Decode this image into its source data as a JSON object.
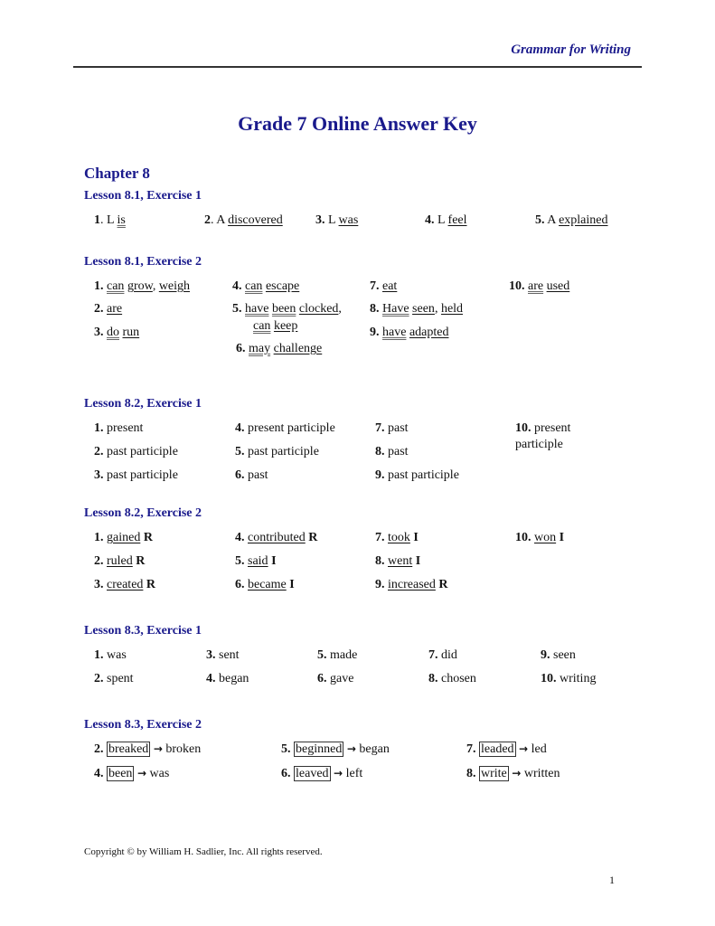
{
  "header": {
    "title": "Grammar for Writing"
  },
  "document": {
    "title": "Grade 7 Online Answer Key",
    "chapter": "Chapter 8"
  },
  "sections": [
    {
      "heading": "Lesson 8.1, Exercise 1",
      "answers": [
        {
          "num": "1",
          "sep": ". ",
          "parts": [
            {
              "t": "L "
            },
            {
              "t": "is",
              "s": "uu"
            }
          ]
        },
        {
          "num": "2",
          "sep": ". ",
          "parts": [
            {
              "t": "A "
            },
            {
              "t": "discovered",
              "s": "u"
            }
          ]
        },
        {
          "num": "3.",
          "sep": " ",
          "parts": [
            {
              "t": "L "
            },
            {
              "t": "was",
              "s": "u"
            }
          ]
        },
        {
          "num": "4.",
          "sep": " ",
          "parts": [
            {
              "t": "L "
            },
            {
              "t": "feel",
              "s": "u"
            }
          ]
        },
        {
          "num": "5.",
          "sep": " ",
          "parts": [
            {
              "t": "A "
            },
            {
              "t": "explained",
              "s": "u"
            }
          ]
        }
      ]
    },
    {
      "heading": "Lesson 8.1, Exercise 2",
      "answers": [
        {
          "num": "1.",
          "sep": " ",
          "parts": [
            {
              "t": "can",
              "s": "uu"
            },
            {
              "t": " "
            },
            {
              "t": "grow",
              "s": "u"
            },
            {
              "t": ", "
            },
            {
              "t": "weigh",
              "s": "u"
            }
          ]
        },
        {
          "num": "2.",
          "sep": " ",
          "parts": [
            {
              "t": "are",
              "s": "u"
            }
          ]
        },
        {
          "num": "3.",
          "sep": " ",
          "parts": [
            {
              "t": "do",
              "s": "uu"
            },
            {
              "t": " "
            },
            {
              "t": "run",
              "s": "u"
            }
          ]
        },
        {
          "num": "4.",
          "sep": " ",
          "parts": [
            {
              "t": "can",
              "s": "uu"
            },
            {
              "t": " "
            },
            {
              "t": "escape",
              "s": "u"
            }
          ]
        },
        {
          "num": "5.",
          "sep": " ",
          "parts": [
            {
              "t": "have",
              "s": "uu"
            },
            {
              "t": " "
            },
            {
              "t": "been",
              "s": "uu"
            },
            {
              "t": " "
            },
            {
              "t": "clocked",
              "s": "u"
            },
            {
              "t": ","
            }
          ],
          "cont": [
            {
              "t": "can",
              "s": "uu"
            },
            {
              "t": " "
            },
            {
              "t": "keep",
              "s": "u"
            }
          ]
        },
        {
          "num": "6.",
          "sep": " ",
          "parts": [
            {
              "t": "may",
              "s": "uu"
            },
            {
              "t": " "
            },
            {
              "t": "challenge",
              "s": "u"
            }
          ]
        },
        {
          "num": "7.",
          "sep": " ",
          "parts": [
            {
              "t": "eat",
              "s": "u"
            }
          ]
        },
        {
          "num": "8.",
          "sep": " ",
          "parts": [
            {
              "t": "Have",
              "s": "uu"
            },
            {
              "t": " "
            },
            {
              "t": "seen",
              "s": "u"
            },
            {
              "t": ", "
            },
            {
              "t": "held",
              "s": "u"
            }
          ]
        },
        {
          "num": "9.",
          "sep": " ",
          "parts": [
            {
              "t": "have",
              "s": "uu"
            },
            {
              "t": " "
            },
            {
              "t": "adapted",
              "s": "u"
            }
          ]
        },
        {
          "num": "10.",
          "sep": " ",
          "parts": [
            {
              "t": "are",
              "s": "uu"
            },
            {
              "t": " "
            },
            {
              "t": "used",
              "s": "u"
            }
          ]
        }
      ]
    },
    {
      "heading": "Lesson 8.2, Exercise 1",
      "answers": [
        {
          "num": "1.",
          "sep": " ",
          "parts": [
            {
              "t": "present"
            }
          ]
        },
        {
          "num": "2.",
          "sep": " ",
          "parts": [
            {
              "t": "past participle"
            }
          ]
        },
        {
          "num": "3.",
          "sep": " ",
          "parts": [
            {
              "t": "past participle"
            }
          ]
        },
        {
          "num": "4.",
          "sep": " ",
          "parts": [
            {
              "t": "present participle"
            }
          ]
        },
        {
          "num": "5.",
          "sep": " ",
          "parts": [
            {
              "t": "past participle"
            }
          ]
        },
        {
          "num": "6.",
          "sep": " ",
          "parts": [
            {
              "t": "past"
            }
          ]
        },
        {
          "num": "7.",
          "sep": " ",
          "parts": [
            {
              "t": "past"
            }
          ]
        },
        {
          "num": "8.",
          "sep": " ",
          "parts": [
            {
              "t": "past"
            }
          ]
        },
        {
          "num": "9.",
          "sep": " ",
          "parts": [
            {
              "t": "past participle"
            }
          ]
        },
        {
          "num": "10.",
          "sep": " ",
          "parts": [
            {
              "t": "present"
            }
          ],
          "cont": [
            {
              "t": "participle"
            }
          ]
        }
      ]
    },
    {
      "heading": "Lesson 8.2, Exercise 2",
      "answers": [
        {
          "num": "1.",
          "sep": " ",
          "parts": [
            {
              "t": "gained",
              "s": "u"
            },
            {
              "t": " "
            },
            {
              "t": "R",
              "s": "b"
            }
          ]
        },
        {
          "num": "2.",
          "sep": " ",
          "parts": [
            {
              "t": "ruled",
              "s": "u"
            },
            {
              "t": " "
            },
            {
              "t": "R",
              "s": "b"
            }
          ]
        },
        {
          "num": "3.",
          "sep": " ",
          "parts": [
            {
              "t": "created",
              "s": "u"
            },
            {
              "t": " "
            },
            {
              "t": "R",
              "s": "b"
            }
          ]
        },
        {
          "num": "4.",
          "sep": " ",
          "parts": [
            {
              "t": "contributed",
              "s": "u"
            },
            {
              "t": " "
            },
            {
              "t": "R",
              "s": "b"
            }
          ]
        },
        {
          "num": "5.",
          "sep": " ",
          "parts": [
            {
              "t": "said",
              "s": "u"
            },
            {
              "t": " "
            },
            {
              "t": "I",
              "s": "b"
            }
          ]
        },
        {
          "num": "6.",
          "sep": " ",
          "parts": [
            {
              "t": "became",
              "s": "u"
            },
            {
              "t": " "
            },
            {
              "t": "I",
              "s": "b"
            }
          ]
        },
        {
          "num": "7.",
          "sep": " ",
          "parts": [
            {
              "t": "took",
              "s": "u"
            },
            {
              "t": " "
            },
            {
              "t": "I",
              "s": "b"
            }
          ]
        },
        {
          "num": "8.",
          "sep": " ",
          "parts": [
            {
              "t": "went",
              "s": "u"
            },
            {
              "t": " "
            },
            {
              "t": "I",
              "s": "b"
            }
          ]
        },
        {
          "num": "9.",
          "sep": " ",
          "parts": [
            {
              "t": "increased",
              "s": "u"
            },
            {
              "t": " "
            },
            {
              "t": "R",
              "s": "b"
            }
          ]
        },
        {
          "num": "10.",
          "sep": " ",
          "parts": [
            {
              "t": "won",
              "s": "u"
            },
            {
              "t": " "
            },
            {
              "t": "I",
              "s": "b"
            }
          ]
        }
      ]
    },
    {
      "heading": "Lesson 8.3, Exercise 1",
      "answers": [
        {
          "num": "1.",
          "sep": " ",
          "parts": [
            {
              "t": "was"
            }
          ]
        },
        {
          "num": "2.",
          "sep": " ",
          "parts": [
            {
              "t": "spent"
            }
          ]
        },
        {
          "num": "3.",
          "sep": " ",
          "parts": [
            {
              "t": "sent"
            }
          ]
        },
        {
          "num": "4.",
          "sep": " ",
          "parts": [
            {
              "t": "began"
            }
          ]
        },
        {
          "num": "5.",
          "sep": " ",
          "parts": [
            {
              "t": "made"
            }
          ]
        },
        {
          "num": "6.",
          "sep": " ",
          "parts": [
            {
              "t": "gave"
            }
          ]
        },
        {
          "num": "7.",
          "sep": " ",
          "parts": [
            {
              "t": "did"
            }
          ]
        },
        {
          "num": "8.",
          "sep": " ",
          "parts": [
            {
              "t": "chosen"
            }
          ]
        },
        {
          "num": "9.",
          "sep": " ",
          "parts": [
            {
              "t": "seen"
            }
          ]
        },
        {
          "num": "10.",
          "sep": " ",
          "parts": [
            {
              "t": "writing"
            }
          ]
        }
      ]
    },
    {
      "heading": "Lesson 8.3, Exercise 2",
      "answers": [
        {
          "num": "2.",
          "sep": " ",
          "parts": [
            {
              "t": "breaked",
              "s": "box"
            },
            {
              "t": " "
            },
            {
              "t": "→",
              "s": "arrow"
            },
            {
              "t": " broken"
            }
          ]
        },
        {
          "num": "4.",
          "sep": " ",
          "parts": [
            {
              "t": "been",
              "s": "box"
            },
            {
              "t": " "
            },
            {
              "t": "→",
              "s": "arrow"
            },
            {
              "t": " was"
            }
          ]
        },
        {
          "num": "5.",
          "sep": " ",
          "parts": [
            {
              "t": "beginned",
              "s": "box"
            },
            {
              "t": " "
            },
            {
              "t": "→",
              "s": "arrow"
            },
            {
              "t": " began"
            }
          ]
        },
        {
          "num": "6.",
          "sep": " ",
          "parts": [
            {
              "t": "leaved",
              "s": "box"
            },
            {
              "t": " "
            },
            {
              "t": "→",
              "s": "arrow"
            },
            {
              "t": " left"
            }
          ]
        },
        {
          "num": "7.",
          "sep": " ",
          "parts": [
            {
              "t": "leaded",
              "s": "box"
            },
            {
              "t": " "
            },
            {
              "t": "→",
              "s": "arrow"
            },
            {
              "t": " led"
            }
          ]
        },
        {
          "num": "8.",
          "sep": " ",
          "parts": [
            {
              "t": "write",
              "s": "box"
            },
            {
              "t": " "
            },
            {
              "t": "→",
              "s": "arrow"
            },
            {
              "t": " written"
            }
          ]
        }
      ]
    }
  ],
  "footer": {
    "copyright": "Copyright © by William H. Sadlier, Inc. All rights reserved.",
    "page_number": "1"
  }
}
